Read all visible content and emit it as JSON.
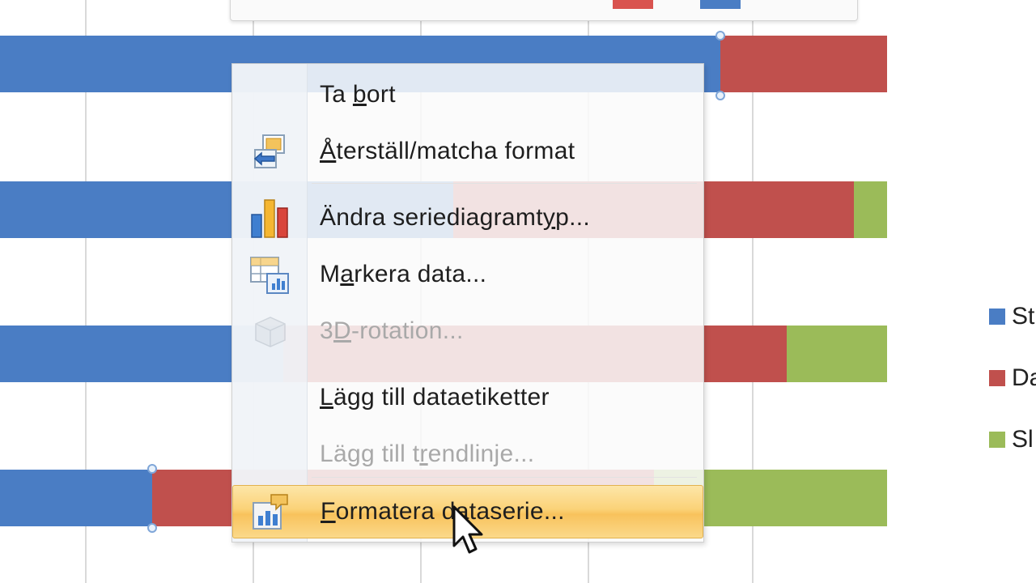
{
  "context_menu": {
    "items": [
      {
        "id": "delete",
        "label": "Ta bort",
        "mnemonic": "b",
        "icon": "none",
        "enabled": true
      },
      {
        "id": "reset-format",
        "label": "Återställ/matcha format",
        "mnemonic": "Å",
        "icon": "reset-format-icon",
        "enabled": true
      },
      {
        "id": "change-chart-type",
        "label": "Ändra seriediagramtyp...",
        "mnemonic": "y",
        "icon": "bar-chart-icon",
        "enabled": true
      },
      {
        "id": "select-data",
        "label": "Markera data...",
        "mnemonic": "a",
        "icon": "select-data-icon",
        "enabled": true
      },
      {
        "id": "3d-rotation",
        "label": "3D-rotation...",
        "mnemonic": "D",
        "icon": "3d-rotation-icon",
        "enabled": false
      },
      {
        "id": "add-data-labels",
        "label": "Lägg till dataetiketter",
        "mnemonic": "L",
        "icon": "none",
        "enabled": true
      },
      {
        "id": "add-trendline",
        "label": "Lägg till trendlinje...",
        "mnemonic": "r",
        "icon": "none",
        "enabled": false
      },
      {
        "id": "format-data-series",
        "label": "Formatera dataserie...",
        "mnemonic": "F",
        "icon": "format-series-icon",
        "enabled": true,
        "highlighted": true
      }
    ]
  },
  "legend": {
    "items": [
      {
        "label": "St",
        "color": "#4a7dc4"
      },
      {
        "label": "Da",
        "color": "#c0504d"
      },
      {
        "label": "Sl",
        "color": "#9bbb59"
      }
    ]
  },
  "colors": {
    "series_blue": "#4a7dc4",
    "series_red": "#c0504d",
    "series_green": "#9bbb59",
    "highlight": "#fbd278"
  }
}
